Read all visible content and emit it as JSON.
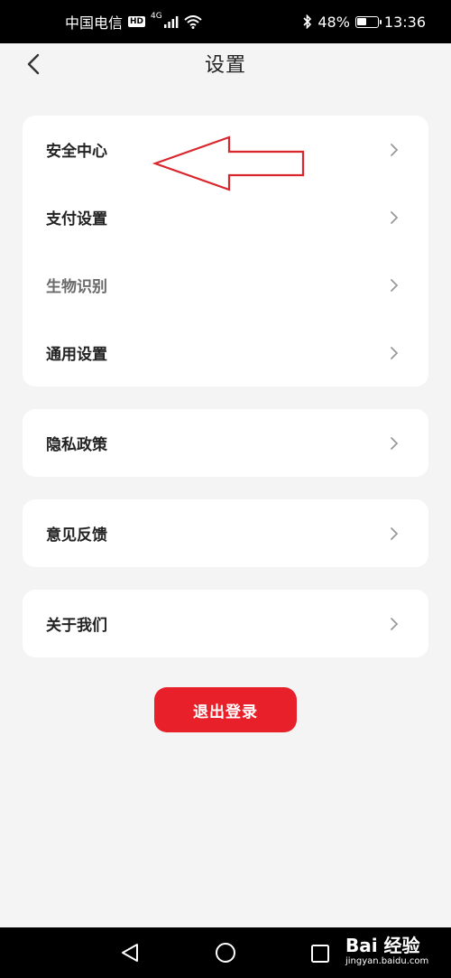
{
  "status_bar": {
    "carrier": "中国电信",
    "hd": "HD",
    "network": "4G",
    "battery": "48%",
    "battery_level": 0.48,
    "time": "13:36"
  },
  "header": {
    "title": "设置"
  },
  "groups": [
    {
      "items": [
        {
          "label": "安全中心"
        },
        {
          "label": "支付设置"
        },
        {
          "label": "生物识别"
        },
        {
          "label": "通用设置"
        }
      ]
    },
    {
      "items": [
        {
          "label": "隐私政策"
        }
      ]
    },
    {
      "items": [
        {
          "label": "意见反馈"
        }
      ]
    },
    {
      "items": [
        {
          "label": "关于我们"
        }
      ]
    }
  ],
  "logout_label": "退出登录",
  "watermark": {
    "main": "Bai 经验",
    "sub": "jingyan.baidu.com"
  },
  "colors": {
    "accent": "#e8202a",
    "annotation": "#d9262c",
    "background": "#f4f4f4"
  },
  "icons": [
    "back-icon",
    "chevron-right-icon",
    "wifi-icon",
    "signal-icon",
    "bluetooth-icon",
    "battery-icon",
    "nav-back-icon",
    "nav-home-icon",
    "nav-recent-icon",
    "arrow-annotation"
  ]
}
